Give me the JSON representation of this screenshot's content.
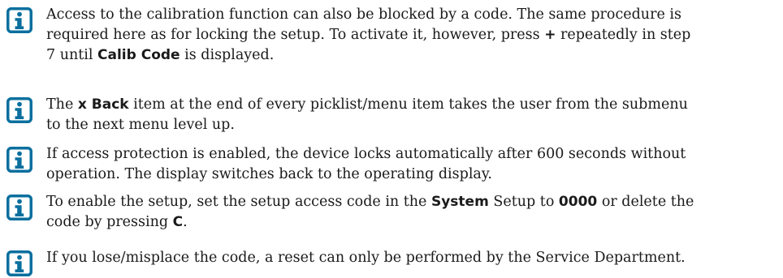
{
  "notes": [
    {
      "icon": "information-icon",
      "lines": [
        [
          "Access to the calibration function can also be blocked by a code. The same procedure is"
        ],
        [
          "required here as for locking the setup. To activate it, however, press ",
          {
            "b": "+"
          },
          " repeatedly in step"
        ],
        [
          "7 until ",
          {
            "b": "Calib Code"
          },
          " is displayed."
        ]
      ]
    },
    {
      "icon": "information-icon",
      "lines": [
        [
          "The ",
          {
            "b": "x Back"
          },
          " item at the end of every picklist/menu item takes the user from the submenu"
        ],
        [
          "to the next menu level up."
        ]
      ]
    },
    {
      "icon": "information-icon",
      "lines": [
        [
          "If access protection is enabled, the device locks automatically after 600 seconds without"
        ],
        [
          "operation. The display switches back to the operating display."
        ]
      ]
    },
    {
      "icon": "information-icon",
      "lines": [
        [
          "To enable the setup, set the setup access code in the ",
          {
            "b": "System"
          },
          " Setup to ",
          {
            "b": "0000"
          },
          " or delete the"
        ],
        [
          "code by pressing ",
          {
            "b": "C"
          },
          "."
        ]
      ]
    },
    {
      "icon": "information-icon",
      "lines": [
        [
          "If you lose/misplace the code, a reset can only be performed by the Service Department."
        ]
      ]
    }
  ],
  "colors": {
    "icon": "#0a6f9e",
    "text": "#1a1a1a"
  }
}
